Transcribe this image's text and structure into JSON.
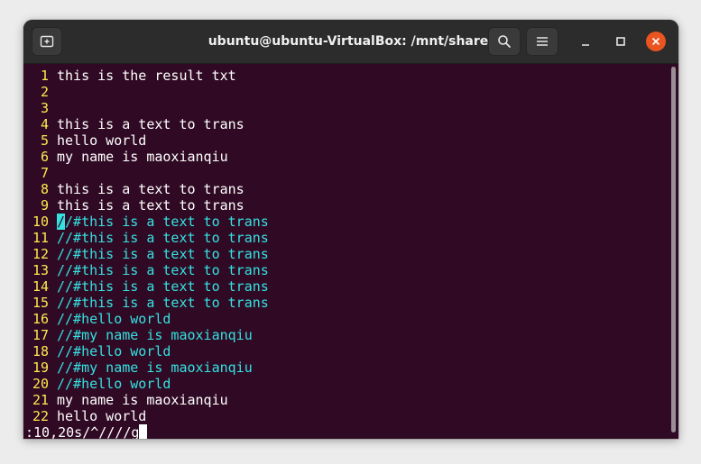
{
  "window": {
    "title": "ubuntu@ubuntu-VirtualBox: /mnt/share"
  },
  "titlebar": {
    "new_tab_icon": "new-tab-icon",
    "search_icon": "search-icon",
    "menu_icon": "hamburger-menu-icon",
    "minimize_icon": "minimize-icon",
    "maximize_icon": "maximize-icon",
    "close_icon": "close-icon"
  },
  "colors": {
    "background": "#300a24",
    "line_numbers": "#fce94f",
    "text": "#ffffff",
    "comment": "#34e2e2",
    "close_button": "#e95420",
    "titlebar": "#2c2c2c"
  },
  "editor": {
    "lines": [
      {
        "num": "1",
        "text": "this is the result txt",
        "style": "normal"
      },
      {
        "num": "2",
        "text": "",
        "style": "normal"
      },
      {
        "num": "3",
        "text": "",
        "style": "normal"
      },
      {
        "num": "4",
        "text": "this is a text to trans",
        "style": "normal"
      },
      {
        "num": "5",
        "text": "hello world",
        "style": "normal"
      },
      {
        "num": "6",
        "text": "my name is maoxianqiu",
        "style": "normal"
      },
      {
        "num": "7",
        "text": "",
        "style": "normal"
      },
      {
        "num": "8",
        "text": "this is a text to trans",
        "style": "normal"
      },
      {
        "num": "9",
        "text": "this is a text to trans",
        "style": "normal"
      },
      {
        "num": "10",
        "text": "//#this is a text to trans",
        "style": "comment",
        "cursor": true
      },
      {
        "num": "11",
        "text": "//#this is a text to trans",
        "style": "comment"
      },
      {
        "num": "12",
        "text": "//#this is a text to trans",
        "style": "comment"
      },
      {
        "num": "13",
        "text": "//#this is a text to trans",
        "style": "comment"
      },
      {
        "num": "14",
        "text": "//#this is a text to trans",
        "style": "comment"
      },
      {
        "num": "15",
        "text": "//#this is a text to trans",
        "style": "comment"
      },
      {
        "num": "16",
        "text": "//#hello world",
        "style": "comment"
      },
      {
        "num": "17",
        "text": "//#my name is maoxianqiu",
        "style": "comment"
      },
      {
        "num": "18",
        "text": "//#hello world",
        "style": "comment"
      },
      {
        "num": "19",
        "text": "//#my name is maoxianqiu",
        "style": "comment"
      },
      {
        "num": "20",
        "text": "//#hello world",
        "style": "comment"
      },
      {
        "num": "21",
        "text": "my name is maoxianqiu",
        "style": "normal"
      },
      {
        "num": "22",
        "text": "hello world",
        "style": "normal"
      }
    ],
    "command": ":10,20s/^////g"
  }
}
